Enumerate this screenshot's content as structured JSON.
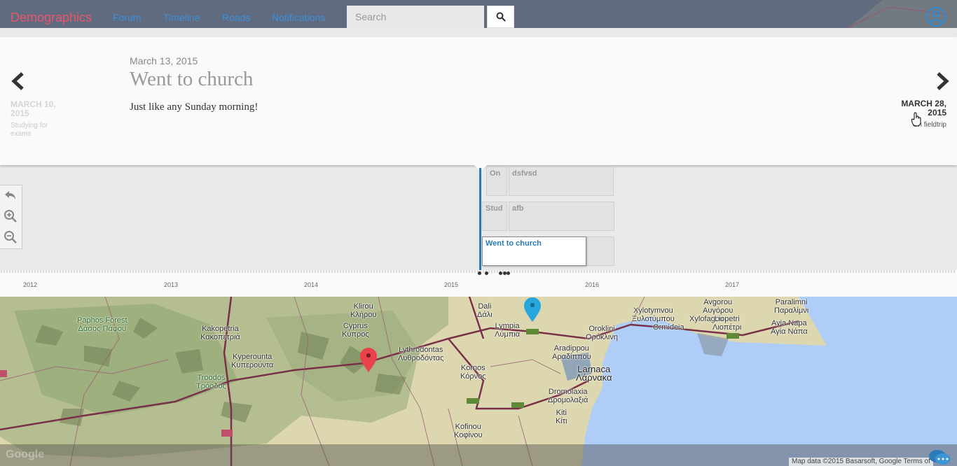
{
  "navbar": {
    "brand": "Demographics",
    "links": [
      "Forum",
      "Timeline",
      "Roads",
      "Notifications"
    ],
    "search_placeholder": "Search",
    "search_icon": "search-icon",
    "user_icon": "user-icon"
  },
  "slide": {
    "date": "March 13, 2015",
    "title": "Went to church",
    "text": "Just like any Sunday morning!"
  },
  "prev": {
    "date": "MARCH 10, 2015",
    "description": "Studying for exams"
  },
  "next": {
    "date": "MARCH 28, 2015",
    "description": "On fieldtrip"
  },
  "zoom_tools": [
    "undo-icon",
    "zoom-in-icon",
    "zoom-out-icon"
  ],
  "events": [
    {
      "label": "On"
    },
    {
      "label": "dsfvsd"
    },
    {
      "label": "Stud"
    },
    {
      "label": "afb"
    },
    {
      "label": "Went to church",
      "active": true
    }
  ],
  "axis": {
    "years": [
      "2012",
      "2013",
      "2014",
      "2015",
      "2016",
      "2017"
    ]
  },
  "map": {
    "labels": [
      {
        "text": "Paphos Forest\nΔάσος Πάφου",
        "style": "green"
      },
      {
        "text": "Kakopetria\nΚακοπετριά",
        "style": ""
      },
      {
        "text": "Kyperounta\nΚυπερούντα",
        "style": ""
      },
      {
        "text": "Troodos\nΤρόοδος",
        "style": "green"
      },
      {
        "text": "Klirou\nΚλήρου",
        "style": ""
      },
      {
        "text": "Cyprus\nΚύπρος",
        "style": ""
      },
      {
        "text": "Lythrodontas\nΛυθροδόντας",
        "style": ""
      },
      {
        "text": "Dali\nΔάλι",
        "style": ""
      },
      {
        "text": "Lympia\nΛύμπια",
        "style": ""
      },
      {
        "text": "Kornos\nΚόρνος",
        "style": ""
      },
      {
        "text": "Aradippou\nΑραδίππου",
        "style": ""
      },
      {
        "text": "Larnaca\nΛάρνακα",
        "style": "big"
      },
      {
        "text": "Dromolaxia\nΔρομολαξιά",
        "style": ""
      },
      {
        "text": "Kiti\nΚίτι",
        "style": ""
      },
      {
        "text": "Kofinou\nΚοφίνου",
        "style": ""
      },
      {
        "text": "Oroklini\nΟρόκλινη",
        "style": ""
      },
      {
        "text": "Ormideia",
        "style": ""
      },
      {
        "text": "Xylotymvou\nΞυλοτύμπου",
        "style": ""
      },
      {
        "text": "Xylofagou",
        "style": ""
      },
      {
        "text": "Liopetri\nΛιοπέτρι",
        "style": ""
      },
      {
        "text": "Avgorou\nΑυγόρου",
        "style": ""
      },
      {
        "text": "Paralimni\nΠαραλίμνι",
        "style": ""
      },
      {
        "text": "Ayia Napa\nΑγία Νάπα",
        "style": ""
      }
    ],
    "attribution": "Map data ©2015 Basarsoft, Google   Terms of",
    "google_logo": "Google",
    "colors": {
      "land": "#d8d4ad",
      "forest": "#a9b88a",
      "sea": "#a8c8f8",
      "road": "#7a3048",
      "pin_red": "#e8424a",
      "pin_blue": "#27a6de"
    }
  }
}
